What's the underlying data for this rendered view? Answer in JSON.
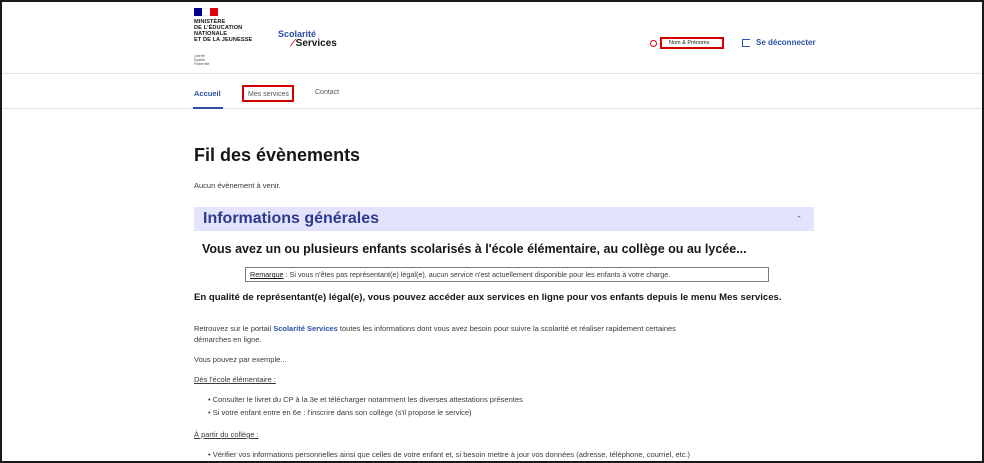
{
  "header": {
    "ministry_line1": "MINISTÈRE",
    "ministry_line2": "DE L'ÉDUCATION",
    "ministry_line3": "NATIONALE",
    "ministry_line4": "ET DE LA JEUNESSE",
    "devise_line1": "Liberté",
    "devise_line2": "Égalité",
    "devise_line3": "Fraternité",
    "brand_top": "Scolarité",
    "brand_bottom": "Services",
    "user_name": "Nom & Prénoms",
    "logout_label": "Se déconnecter"
  },
  "nav": {
    "items": [
      {
        "label": "Accueil"
      },
      {
        "label": "Mes services"
      },
      {
        "label": "Contact"
      }
    ]
  },
  "main": {
    "events_title": "Fil des évènements",
    "no_events": "Aucun évènement à venir.",
    "accordion_title": "Informations générales",
    "subtitle": "Vous avez un ou plusieurs enfants scolarisés à l'école élémentaire, au collège ou au lycée...",
    "remark_label": "Remarque",
    "remark_text": " : Si vous n'êtes pas représentant(e) légal(e), aucun service n'est actuellement disponible pour les enfants à votre charge.",
    "quality_heading": "En qualité de représentant(e) légal(e), vous pouvez accéder aux services en ligne pour vos enfants depuis le menu Mes services.",
    "portal_text_1": "Retrouvez sur le portail ",
    "portal_brand": "Scolarité Services",
    "portal_text_2": " toutes les informations dont vous avez besoin pour suivre la scolarité et réaliser rapidement certaines",
    "portal_text_3": "démarches en ligne.",
    "example": "Vous pouvez par exemple...",
    "elementary_label": "Dès l'école élémentaire :",
    "elementary_items": [
      "Consulter le livret du CP à la 3e et télécharger notamment les diverses attestations présentes",
      "Si votre enfant entre en 6e : l'inscrire dans son collège (s'il propose le service)"
    ],
    "college_label": "À partir du collège :",
    "college_items": [
      "Vérifier vos informations personnelles ainsi que celles de votre enfant et, si besoin mettre à jour vos données (adresse, téléphone, courriel, etc.)"
    ]
  },
  "colors": {
    "accent_blue": "#2e4fa8",
    "highlight_red": "#d40000",
    "accordion_bg": "#e3e3fd"
  }
}
